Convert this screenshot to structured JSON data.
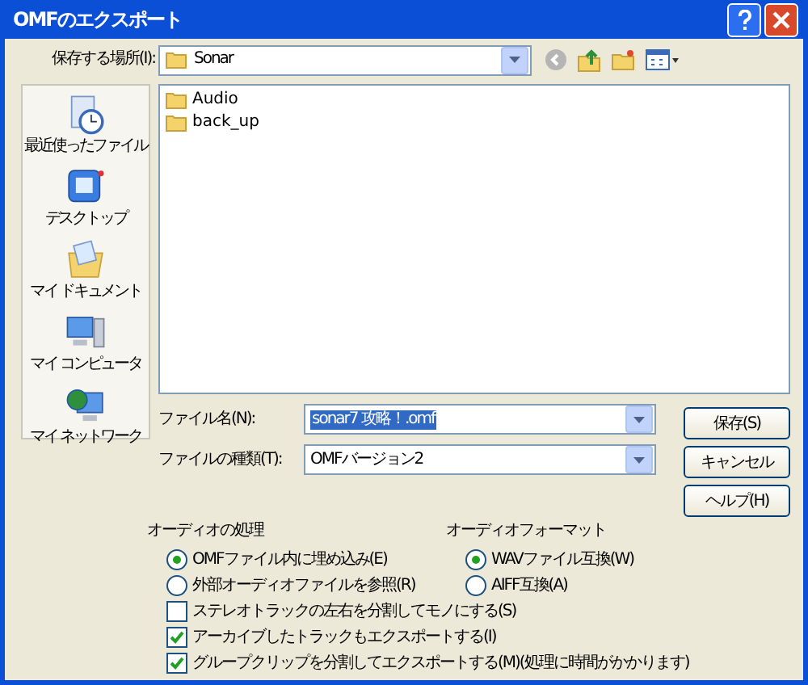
{
  "window": {
    "title": "OMFのエクスポート"
  },
  "location": {
    "label": "保存する場所(I):",
    "value": "Sonar"
  },
  "places": [
    {
      "label": "最近使ったファイル",
      "kind": "recent"
    },
    {
      "label": "デスクトップ",
      "kind": "desktop"
    },
    {
      "label": "マイ ドキュメント",
      "kind": "documents"
    },
    {
      "label": "マイ コンピュータ",
      "kind": "computer"
    },
    {
      "label": "マイ ネットワーク",
      "kind": "network"
    }
  ],
  "files": [
    {
      "name": "Audio"
    },
    {
      "name": "back_up"
    }
  ],
  "file_name": {
    "label": "ファイル名(N):",
    "value": "sonar7 攻略！.omf"
  },
  "file_type": {
    "label": "ファイルの種類(T):",
    "value": "OMFバージョン2"
  },
  "buttons": [
    "保存(S)",
    "キャンセル",
    "ヘルプ(H)"
  ],
  "audio_processing": {
    "title": "オーディオの処理",
    "options": [
      {
        "label": "OMFファイル内に埋め込み(E)",
        "selected": true
      },
      {
        "label": "外部オーディオファイルを参照(R)",
        "selected": false
      }
    ]
  },
  "audio_format": {
    "title": "オーディオフォーマット",
    "options": [
      {
        "label": "WAVファイル互換(W)",
        "selected": true
      },
      {
        "label": "AIFF互換(A)",
        "selected": false
      }
    ]
  },
  "checkboxes": [
    {
      "label": "ステレオトラックの左右を分割してモノにする(S)",
      "checked": false
    },
    {
      "label": "アーカイブしたトラックもエクスポートする(I)",
      "checked": true
    },
    {
      "label": "グループクリップを分割してエクスポートする(M)(処理に時間がかかります)",
      "checked": true
    }
  ]
}
